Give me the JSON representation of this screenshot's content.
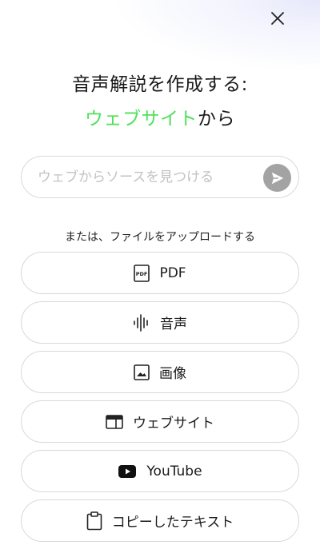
{
  "header": {
    "close_icon": "close-icon"
  },
  "title": {
    "line1": "音声解説を作成する:",
    "accent": "ウェブサイト",
    "suffix": "から",
    "accent_color": "#4fe15a"
  },
  "search": {
    "placeholder": "ウェブからソースを見つける",
    "value": "",
    "send_icon": "send-icon"
  },
  "or_label": "または、ファイルをアップロードする",
  "options": [
    {
      "label": "PDF",
      "icon": "pdf-icon"
    },
    {
      "label": "音声",
      "icon": "audio-waveform-icon"
    },
    {
      "label": "画像",
      "icon": "image-icon"
    },
    {
      "label": "ウェブサイト",
      "icon": "website-icon"
    },
    {
      "label": "YouTube",
      "icon": "youtube-icon"
    },
    {
      "label": "コピーしたテキスト",
      "icon": "clipboard-icon"
    }
  ]
}
